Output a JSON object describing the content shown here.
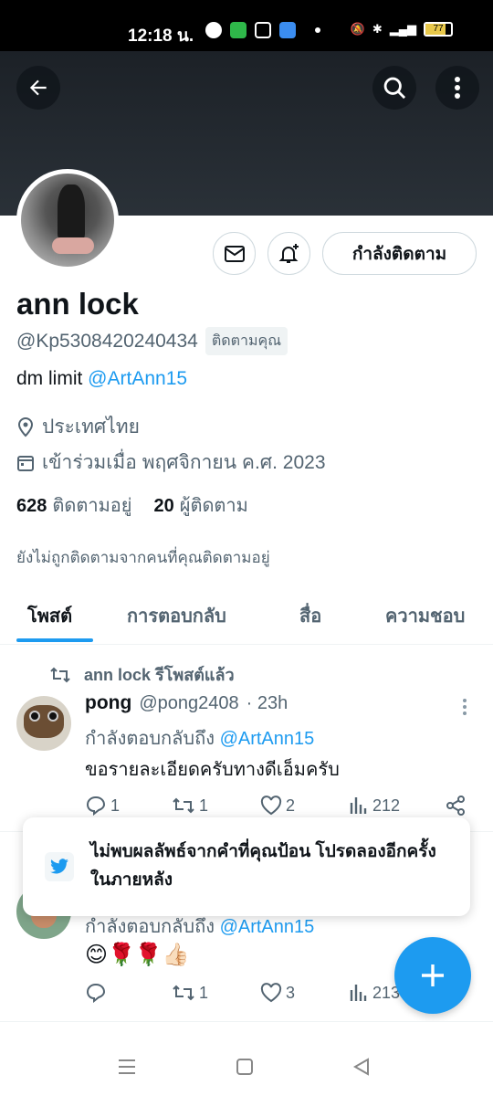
{
  "status_bar": {
    "time": "12:18 น.",
    "battery": "77",
    "battery_level": 0.77
  },
  "profile": {
    "name": "ann lock",
    "handle": "@Kp5308420240434",
    "follows_you": "ติดตามคุณ",
    "bio_text": "dm limit ",
    "bio_mention": "@ArtAnn15",
    "location": "ประเทศไทย",
    "joined": "เข้าร่วมเมื่อ พฤศจิกายน ค.ศ. 2023",
    "following_count": "628",
    "following_label": "ติดตามอยู่",
    "followers_count": "20",
    "followers_label": "ผู้ติดตาม",
    "not_followed_note": "ยังไม่ถูกติดตามจากคนที่คุณติดตามอยู่",
    "follow_button": "กำลังติดตาม"
  },
  "tabs": [
    "โพสต์",
    "การตอบกลับ",
    "สื่อ",
    "ความชอบ"
  ],
  "posts": [
    {
      "repost_label": "ann lock รีโพสต์แล้ว",
      "author": "pong",
      "handle": "@pong2408",
      "time": "· 23h",
      "reply_to_label": "กำลังตอบกลับถึง",
      "reply_to_mention": "@ArtAnn15",
      "text": "ขอรายละเอียดครับทางดีเอ็มครับ",
      "replies": "1",
      "reposts": "1",
      "likes": "2",
      "views": "212"
    },
    {
      "reply_to_label": "กำลังตอบกลับถึง",
      "reply_to_mention": "@ArtAnn15",
      "text": "😊🌹🌹👍🏻",
      "replies": "",
      "reposts": "1",
      "likes": "3",
      "views": "213"
    }
  ],
  "toast": {
    "message": "ไม่พบผลลัพธ์จากคำที่คุณป้อน โปรดลองอีกครั้งในภายหลัง"
  },
  "colors": {
    "accent": "#1d9bf0",
    "text": "#0f1419",
    "muted": "#536471"
  }
}
